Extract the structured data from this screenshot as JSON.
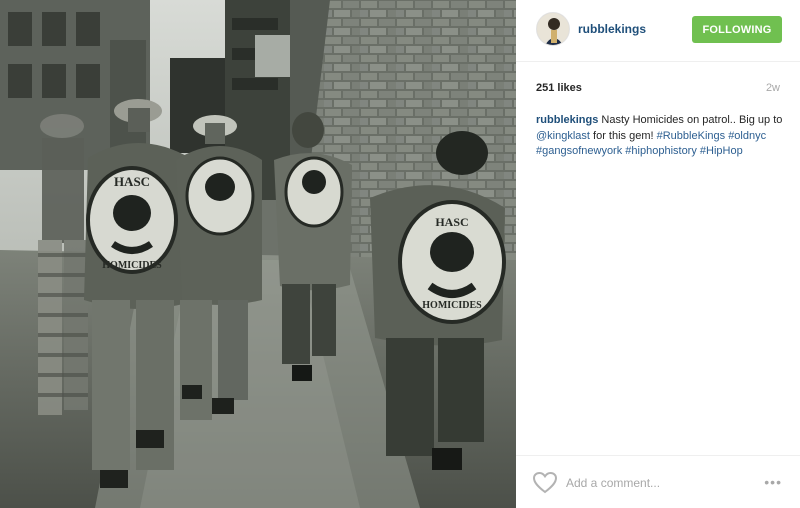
{
  "post": {
    "username": "rubblekings",
    "follow_label": "FOLLOWING",
    "likes": "251 likes",
    "time": "2w",
    "caption": {
      "author": "rubblekings",
      "text1": "Nasty Homicides on patrol.. Big up to ",
      "mention": "@kingklast",
      "text2": " for this gem!",
      "hashtags": [
        "#RubbleKings",
        "#oldnyc",
        "#gangsofnewyork",
        "#hiphophistory",
        "#HipHop"
      ]
    },
    "comment_placeholder": "Add a comment...",
    "more_label": "•••",
    "photo_patch_text": {
      "top": "HASC",
      "bottom": "HOMICIDES"
    }
  },
  "colors": {
    "follow_button": "#70c050",
    "link": "#2d5f91"
  },
  "icons": {
    "like": "heart-outline-icon",
    "more": "more-options-icon",
    "avatar": "profile-avatar"
  }
}
